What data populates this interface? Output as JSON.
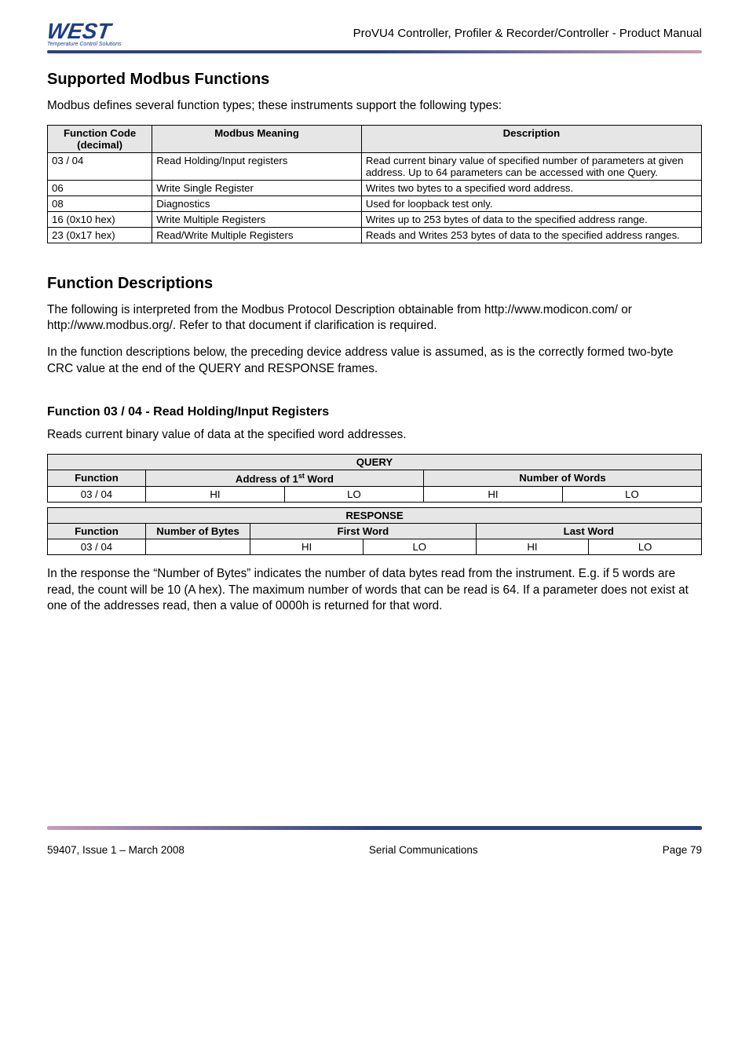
{
  "header": {
    "logo_text": "WEST",
    "logo_tag": "Temperature Control Solutions",
    "doc_title": "ProVU4 Controller, Profiler & Recorder/Controller - Product Manual"
  },
  "section1": {
    "title": "Supported Modbus Functions",
    "intro": "Modbus defines several function types; these instruments support the following types:",
    "table": {
      "headers": [
        "Function Code (decimal)",
        "Modbus Meaning",
        "Description"
      ],
      "rows": [
        [
          "03 / 04",
          "Read Holding/Input registers",
          "Read current binary value of specified number of parameters at given address. Up to 64 parameters can be accessed with one Query."
        ],
        [
          "06",
          "Write Single Register",
          "Writes two bytes to a specified word address."
        ],
        [
          "08",
          "Diagnostics",
          "Used for loopback test only."
        ],
        [
          "16 (0x10 hex)",
          "Write Multiple Registers",
          "Writes up to 253 bytes of data to the specified address range."
        ],
        [
          "23 (0x17 hex)",
          "Read/Write Multiple Registers",
          "Reads and Writes 253 bytes of data to the specified address ranges."
        ]
      ]
    }
  },
  "section2": {
    "title": "Function Descriptions",
    "para1": "The following is interpreted from the Modbus Protocol Description obtainable from http://www.modicon.com/ or http://www.modbus.org/. Refer to that document if clarification is required.",
    "para2": "In the function descriptions below, the preceding device address value is assumed, as is the correctly formed two-byte CRC value at the end of the QUERY and RESPONSE frames."
  },
  "section3": {
    "title": "Function 03 / 04 - Read Holding/Input Registers",
    "intro": "Reads current binary value of data at the specified word addresses.",
    "query": {
      "title": "QUERY",
      "headers": {
        "func": "Function",
        "addr_prefix": "Address of 1",
        "addr_suffix": " Word",
        "num": "Number of Words"
      },
      "row": [
        "03 / 04",
        "HI",
        "LO",
        "HI",
        "LO"
      ]
    },
    "response": {
      "title": "RESPONSE",
      "headers": {
        "func": "Function",
        "bytes": "Number of Bytes",
        "first": "First Word",
        "last": "Last Word"
      },
      "row": [
        "03 / 04",
        "",
        "HI",
        "LO",
        "HI",
        "LO"
      ]
    },
    "outro": "In the response the “Number of Bytes” indicates the number of data bytes read from the instrument. E.g. if 5 words are read, the count will be 10 (A hex). The maximum number of words that can be read is 64. If a parameter does not exist at one of the addresses read, then a value of 0000h is returned for that word."
  },
  "footer": {
    "left": "59407, Issue 1 – March 2008",
    "center": "Serial Communications",
    "right": "Page 79"
  }
}
